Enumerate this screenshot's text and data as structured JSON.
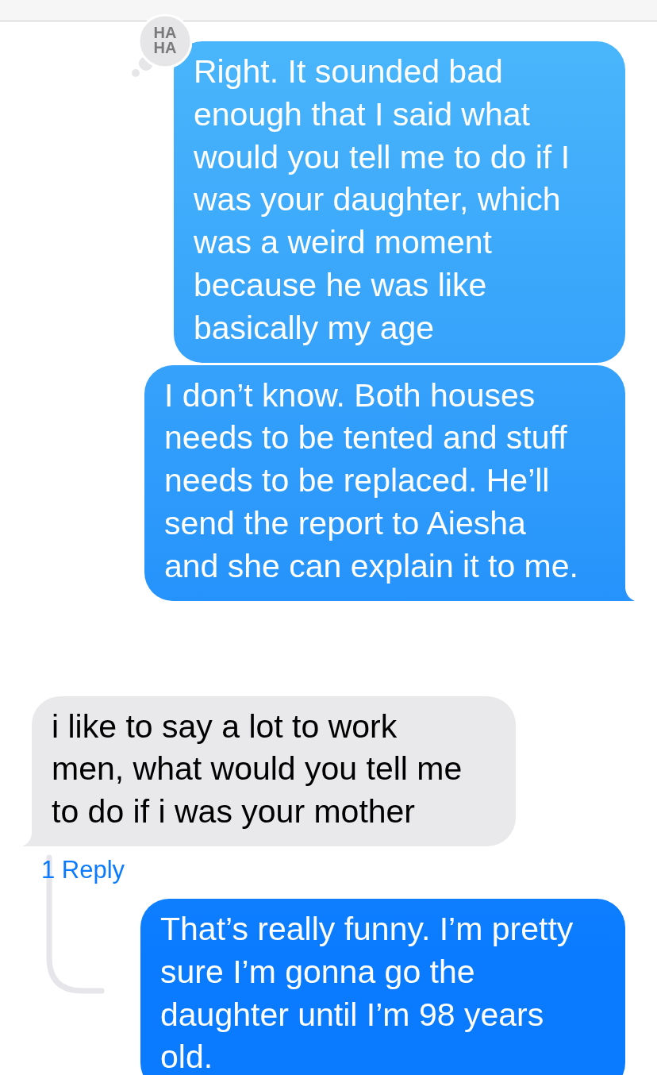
{
  "messages": [
    {
      "kind": "sent",
      "reaction": {
        "kind": "haha",
        "lines": [
          "HA",
          "HA"
        ]
      },
      "tail": false,
      "lines": [
        "Right. It sounded bad",
        "enough that I said what",
        "would you tell me to do if I",
        "was your daughter, which",
        "was a weird moment",
        "because he was like",
        "basically my age"
      ]
    },
    {
      "kind": "sent",
      "tail": true,
      "lines": [
        "I don’t know. Both houses",
        "needs to be tented and stuff",
        "needs to be replaced. He’ll",
        "send the report to Aiesha",
        "and she can explain it to me."
      ]
    },
    {
      "kind": "received",
      "tail": true,
      "lines": [
        "i like to say a lot to work",
        "men, what would you tell me",
        "to do if i was your mother"
      ],
      "replies": "1 Reply"
    },
    {
      "kind": "sent",
      "tail": false,
      "lines": [
        "That’s really funny. I’m pretty",
        "sure I’m gonna go the",
        "daughter until I’m 98 years",
        "old."
      ]
    }
  ]
}
